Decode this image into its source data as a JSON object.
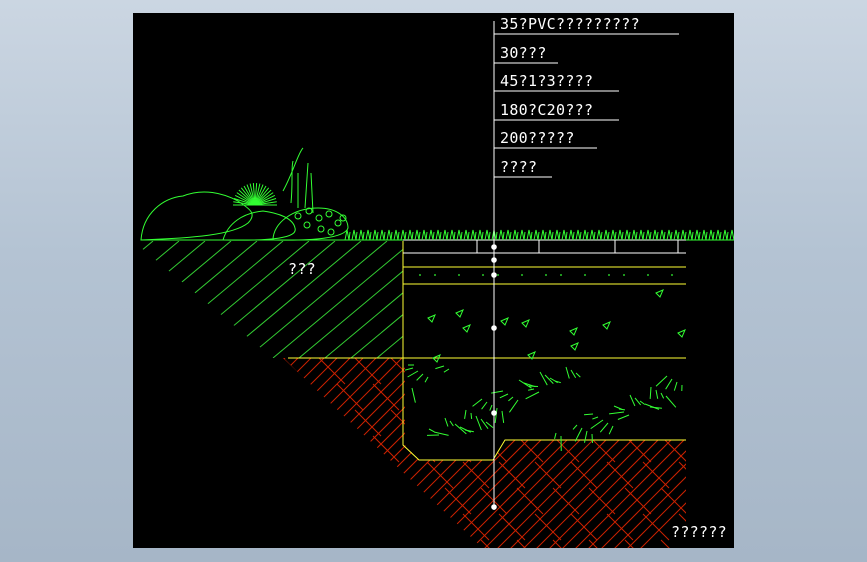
{
  "drawing": {
    "layer_labels": [
      "35?PVC?????????",
      "30???",
      "45?1?3????",
      "180?C20???",
      "200?????",
      "????"
    ],
    "soil_label": "???",
    "footer_label": "??????"
  },
  "colors": {
    "background": "#000000",
    "window": "#b4c3d3",
    "grass": "#33ff33",
    "hatch": "#33cc33",
    "earth_hatch": "#cc2200",
    "layer_line": "#ffff33",
    "leader": "#ffffff"
  }
}
